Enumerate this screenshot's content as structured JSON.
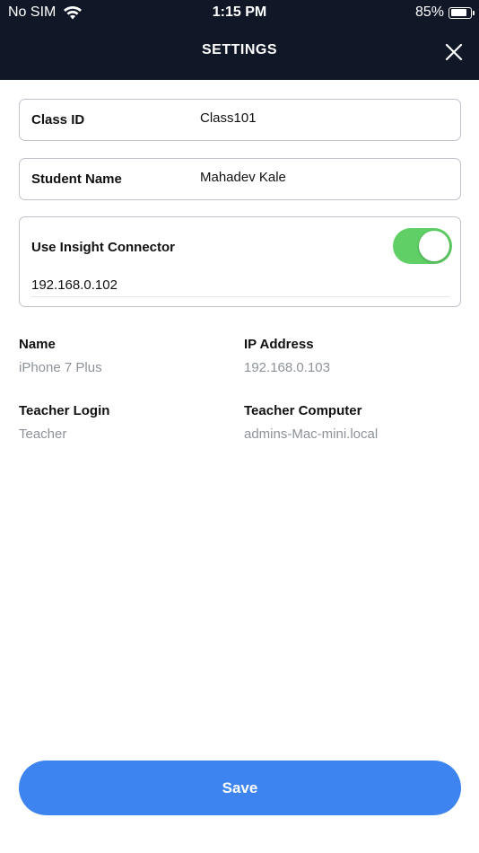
{
  "status_bar": {
    "carrier": "No SIM",
    "time": "1:15 PM",
    "battery": "85%",
    "battery_level": 0.85,
    "wifi_icon": "wifi-icon",
    "battery_icon": "battery-icon"
  },
  "header": {
    "title": "SETTINGS",
    "close_icon": "close-icon",
    "background": "#101828"
  },
  "form": {
    "class_id": {
      "label": "Class ID",
      "value": "Class101"
    },
    "student_name": {
      "label": "Student Name",
      "value": "Mahadev Kale"
    },
    "insight_connector": {
      "label": "Use Insight Connector",
      "enabled": true,
      "toggle_color": "#5fcf66",
      "ip_value": "192.168.0.102"
    }
  },
  "info": {
    "name": {
      "label": "Name",
      "value": "iPhone 7 Plus"
    },
    "ip_address": {
      "label": "IP Address",
      "value": "192.168.0.103"
    },
    "teacher_login": {
      "label": "Teacher Login",
      "value": "Teacher"
    },
    "teacher_computer": {
      "label": "Teacher Computer",
      "value": "admins-Mac-mini.local"
    }
  },
  "save_button": {
    "label": "Save",
    "color": "#3d84f0"
  }
}
